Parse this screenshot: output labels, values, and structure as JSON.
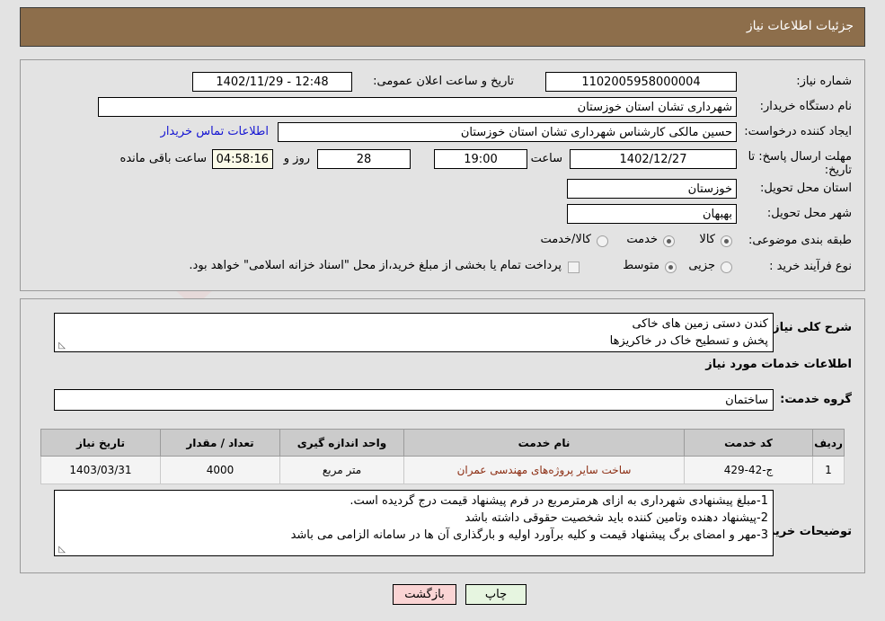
{
  "header": {
    "title": "جزئیات اطلاعات نیاز"
  },
  "form": {
    "need_number_label": "شماره نیاز:",
    "need_number_value": "1102005958000004",
    "announce_label": "تاریخ و ساعت اعلان عمومی:",
    "announce_value": "12:48 - 1402/11/29",
    "buyer_org_label": "نام دستگاه خریدار:",
    "buyer_org_value": "شهرداری تشان استان خوزستان",
    "creator_label": "ایجاد کننده درخواست:",
    "creator_value": "حسین مالکی کارشناس شهرداری تشان استان خوزستان",
    "contact_link": "اطلاعات تماس خریدار",
    "deadline_label": "مهلت ارسال پاسخ: تا تاریخ:",
    "deadline_date": "1402/12/27",
    "hour_label": "ساعت",
    "hour_value": "19:00",
    "days_value": "28",
    "days_suffix": "روز و",
    "remaining_value": "04:58:16",
    "remaining_suffix": "ساعت باقی مانده",
    "province_label": "استان محل تحویل:",
    "province_value": "خوزستان",
    "city_label": "شهر محل تحویل:",
    "city_value": "بهبهان",
    "category_label": "طبقه بندی موضوعی:",
    "category_options": [
      "کالا",
      "خدمت",
      "کالا/خدمت"
    ],
    "category_selected": "خدمت",
    "process_label": "نوع فرآیند خرید :",
    "process_options": [
      "جزیی",
      "متوسط"
    ],
    "process_selected": "متوسط",
    "treasury_checkbox_label": "پرداخت تمام یا بخشی از مبلغ خرید،از محل \"اسناد خزانه اسلامی\" خواهد بود.",
    "treasury_checked": false
  },
  "description": {
    "label": "شرح کلی نیاز:",
    "line1": "کندن دستی زمین های خاکی",
    "line2": "پخش و تسطیح خاک در خاکریزها"
  },
  "services_section": {
    "heading": "اطلاعات خدمات مورد نیاز",
    "group_label": "گروه خدمت:",
    "group_value": "ساختمان"
  },
  "table": {
    "columns": [
      "ردیف",
      "کد خدمت",
      "نام خدمت",
      "واحد اندازه گیری",
      "تعداد / مقدار",
      "تاریخ نیاز"
    ],
    "rows": [
      {
        "index": "1",
        "code": "ج-42-429",
        "name": "ساخت سایر پروژه‌های مهندسی عمران",
        "unit": "متر مربع",
        "quantity": "4000",
        "need_date": "1403/03/31"
      }
    ]
  },
  "buyer_notes": {
    "label": "توضیحات خریدار:",
    "line1": "1-مبلغ پیشنهادی شهرداری به ازای هرمترمربع در فرم پیشنهاد قیمت درج گردیده است.",
    "line2": "2-پیشنهاد دهنده وتامین کننده باید شخصیت حقوقی داشته باشد",
    "line3": "3-مهر و امضای برگ پیشنهاد قیمت و کلیه برآورد اولیه و بارگذاری آن ها در سامانه الزامی می باشد"
  },
  "footer": {
    "back_label": "بازگشت",
    "print_label": "چاپ"
  },
  "watermark": {
    "text": "AnaTender.net"
  },
  "colors": {
    "header_bg": "#8d6e4b",
    "link": "#1414d2",
    "service_name": "#8c2d12",
    "back_btn": "#fad4d4",
    "print_btn": "#e6f5e0",
    "highlight_field": "#fbfbe8"
  }
}
